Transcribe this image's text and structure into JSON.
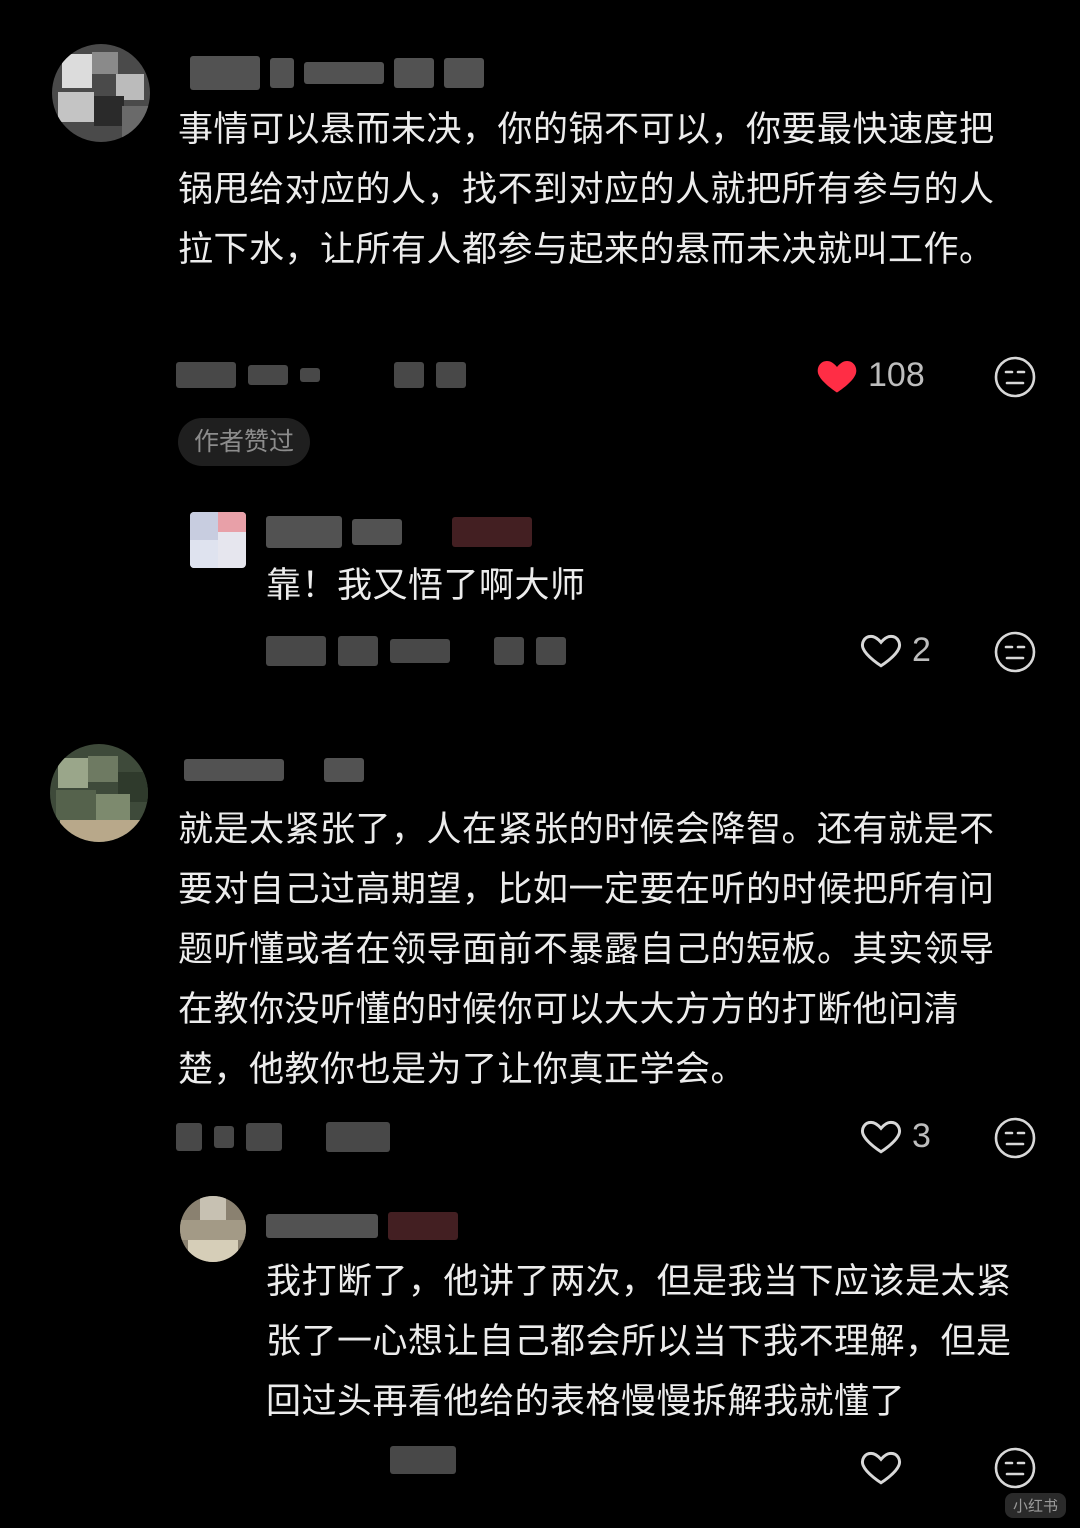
{
  "comments": [
    {
      "text": "事情可以悬而未决，你的锅不可以，你要最快速度把锅甩给对应的人，找不到对应的人就把所有参与的人拉下水，让所有人都参与起来的悬而未决就叫工作。",
      "likes": "108",
      "liked": true,
      "badge": "作者赞过",
      "reply": {
        "text": "靠！我又悟了啊大师",
        "likes": "2"
      }
    },
    {
      "text": "就是太紧张了，人在紧张的时候会降智。还有就是不要对自己过高期望，比如一定要在听的时候把所有问题听懂或者在领导面前不暴露自己的短板。其实领导在教你没听懂的时候你可以大大方方的打断他问清楚，他教你也是为了让你真正学会。",
      "likes": "3",
      "reply": {
        "text": "我打断了，他讲了两次，但是我当下应该是太紧张了一心想让自己都会所以当下我不理解，但是回过头再看他给的表格慢慢拆解我就懂了",
        "likes": ""
      }
    }
  ],
  "watermark": "小红书",
  "icons": {
    "like_filled": "heart-filled-icon",
    "like_outline": "heart-outline-icon",
    "react": "neutral-face-icon"
  },
  "colors": {
    "like_active": "#ff2d45",
    "background": "#000000"
  }
}
